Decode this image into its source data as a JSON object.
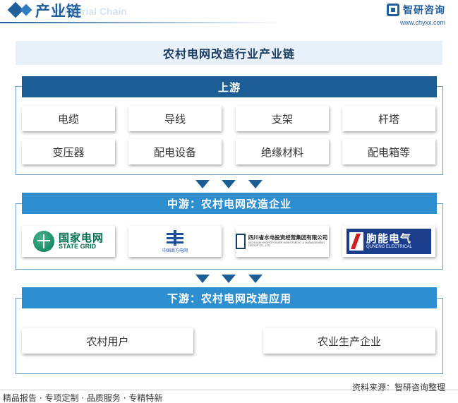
{
  "header": {
    "title": "产业链",
    "subtitle": "Industrial Chain",
    "brand_name": "智研咨询",
    "brand_url": "www.chyxx.com"
  },
  "main_title": "农村电网改造行业产业链",
  "upstream": {
    "label": "上游",
    "items": [
      "电缆",
      "导线",
      "支架",
      "杆塔",
      "变压器",
      "配电设备",
      "绝缘材料",
      "配电箱等"
    ]
  },
  "midstream": {
    "label": "中游：农村电网改造企业",
    "companies": {
      "state_grid_cn": "国家电网",
      "state_grid_en": "STATE GRID",
      "csg_cn": "中国南方电网",
      "sichuan_cn": "四川省水电投资经营集团有限公司",
      "sichuan_en": "SICHUAN HYDROPOWER INVESTMENT & MANAGEMENT GROUP CO.,LTD",
      "quneng_cn": "朐能电气",
      "quneng_en": "QUNENG ELECTRICAL"
    }
  },
  "downstream": {
    "label": "下游：农村电网改造应用",
    "items": [
      "农村用户",
      "农业生产企业"
    ]
  },
  "source": "资料来源：智研咨询整理",
  "footer": "精品报告 · 专项定制 · 品质服务 · 专精特新",
  "colors": {
    "dark_blue": "#1c5d96",
    "light_blue": "#2d8fd0"
  }
}
